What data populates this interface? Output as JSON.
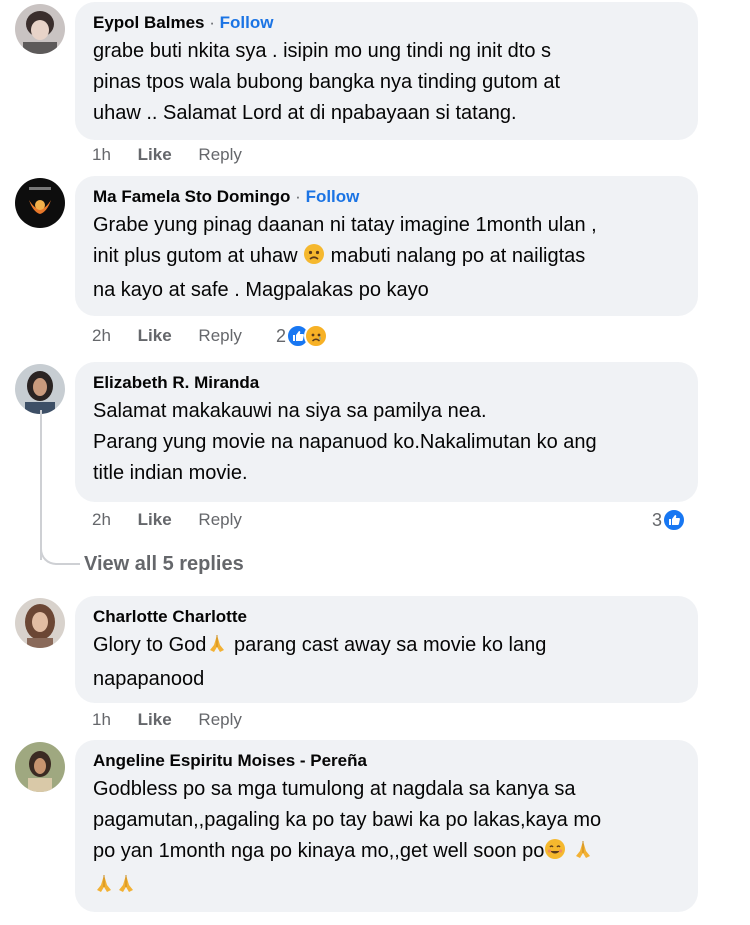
{
  "comments": [
    {
      "name": "Eypol Balmes",
      "follow": "Follow",
      "text": "grabe buti nkita sya . isipin mo ung tindi ng init dto s\npinas tpos wala bubong bangka nya tinding gutom at\nuhaw .. Salamat Lord at di npabayaan si tatang.",
      "time": "1h",
      "like": "Like",
      "reply": "Reply"
    },
    {
      "name": "Ma Famela Sto Domingo",
      "follow": "Follow",
      "text_a": "Grabe yung pinag daanan ni tatay imagine 1month ulan ,\ninit plus gutom at uhaw ",
      "text_b": " mabuti nalang po at nailigtas\nna kayo at safe . Magpalakas po kayo",
      "time": "2h",
      "like": "Like",
      "reply": "Reply",
      "reaction_count": "2"
    },
    {
      "name": "Elizabeth R. Miranda",
      "text": "Salamat makakauwi na siya sa pamilya nea.\nParang yung movie na napanuod ko.Nakalimutan ko ang\ntitle indian movie.",
      "time": "2h",
      "like": "Like",
      "reply": "Reply",
      "reaction_count": "3"
    },
    {
      "name": "Charlotte Charlotte",
      "text_a": "Glory to God",
      "text_b": " parang cast away sa movie ko lang\nnapapanood",
      "time": "1h",
      "like": "Like",
      "reply": "Reply"
    },
    {
      "name": "Angeline Espiritu Moises - Pereña",
      "text": "Godbless po sa mga tumulong at nagdala sa kanya sa\npagamutan,,pagaling ka po tay bawi ka po lakas,kaya mo\npo yan 1month nga po kinaya mo,,get well soon po"
    }
  ],
  "view_replies": "View all 5 replies",
  "colors": {
    "link": "#1b74e4",
    "bubble": "#f0f2f5",
    "meta": "#65676b",
    "like": "#1877f2"
  }
}
